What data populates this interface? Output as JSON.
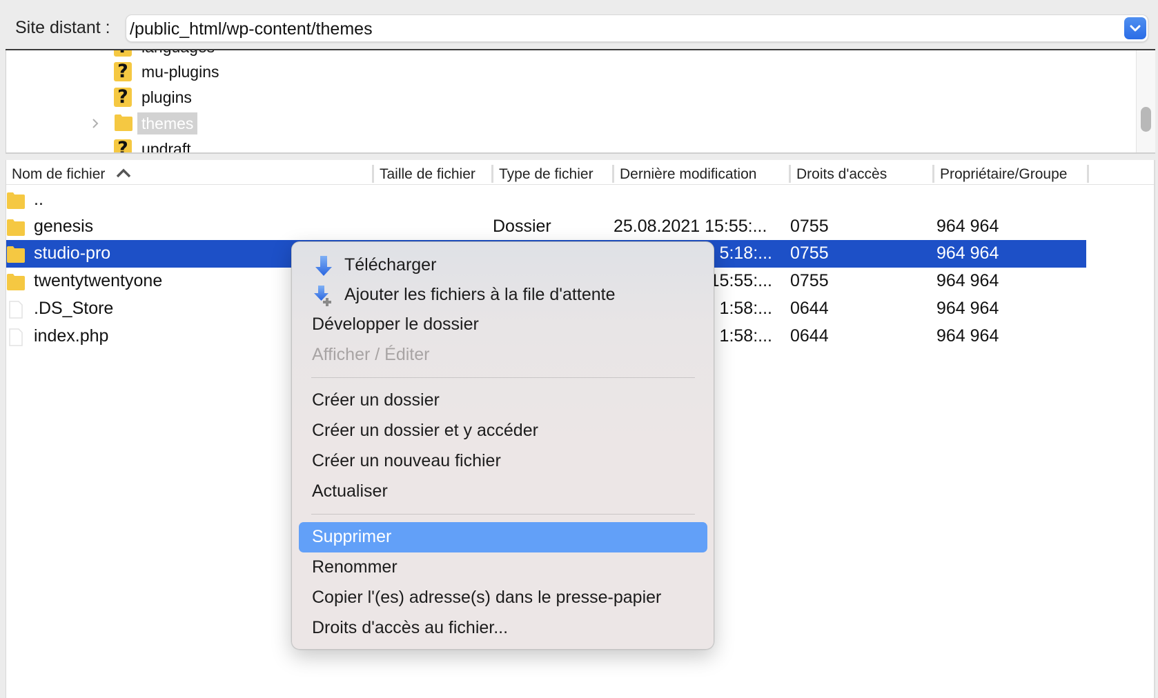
{
  "topbar": {
    "site_label": "Site distant :",
    "path_value": "/public_html/wp-content/themes",
    "dropdown_icon": "chevron-down-icon"
  },
  "tree": {
    "items": [
      {
        "label": "languages",
        "icon": "unknown-folder-icon",
        "clipped": true
      },
      {
        "label": "mu-plugins",
        "icon": "unknown-folder-icon"
      },
      {
        "label": "plugins",
        "icon": "unknown-folder-icon"
      },
      {
        "label": "themes",
        "icon": "folder-icon",
        "selected": true,
        "expandable": true
      },
      {
        "label": "updraft",
        "icon": "unknown-folder-icon",
        "clipped": true
      }
    ]
  },
  "list": {
    "columns": [
      {
        "label": "Nom de fichier",
        "sorted": "ascending"
      },
      {
        "label": "Taille de fichier"
      },
      {
        "label": "Type de fichier"
      },
      {
        "label": "Dernière modification"
      },
      {
        "label": "Droits d'accès"
      },
      {
        "label": "Propriétaire/Groupe"
      }
    ],
    "rows": [
      {
        "name": "..",
        "icon": "folder-icon",
        "size": "",
        "type": "",
        "modified": "",
        "perms": "",
        "owner": ""
      },
      {
        "name": "genesis",
        "icon": "folder-icon",
        "size": "",
        "type": "Dossier",
        "modified": "25.08.2021 15:55:...",
        "perms": "0755",
        "owner": "964 964"
      },
      {
        "name": "studio-pro",
        "icon": "folder-icon",
        "size": "",
        "type": "",
        "modified": "5:18:...",
        "perms": "0755",
        "owner": "964 964",
        "selected": true
      },
      {
        "name": "twentytwentyone",
        "icon": "folder-icon",
        "size": "",
        "type": "",
        "modified": "15:55:...",
        "perms": "0755",
        "owner": "964 964"
      },
      {
        "name": ".DS_Store",
        "icon": "file-icon",
        "size": "",
        "type": "",
        "modified": "1:58:...",
        "perms": "0644",
        "owner": "964 964"
      },
      {
        "name": "index.php",
        "icon": "file-icon",
        "size": "",
        "type": "",
        "modified": "1:58:...",
        "perms": "0644",
        "owner": "964 964"
      }
    ],
    "selected_color": "#1d50c7"
  },
  "context_menu": {
    "items": [
      {
        "label": "Télécharger",
        "icon": "download-arrow-icon"
      },
      {
        "label": "Ajouter les fichiers à la file d'attente",
        "icon": "add-to-queue-icon"
      },
      {
        "label": "Développer le dossier"
      },
      {
        "label": "Afficher / Éditer",
        "disabled": true
      },
      {
        "separator": true
      },
      {
        "label": "Créer un dossier"
      },
      {
        "label": "Créer un dossier et y accéder"
      },
      {
        "label": "Créer un nouveau fichier"
      },
      {
        "label": "Actualiser"
      },
      {
        "separator": true
      },
      {
        "label": "Supprimer",
        "highlighted": true
      },
      {
        "label": "Renommer"
      },
      {
        "label": "Copier l'(es) adresse(s) dans le presse-papier"
      },
      {
        "label": "Droits d'accès au fichier..."
      }
    ],
    "highlight_color": "#62a0f8"
  }
}
